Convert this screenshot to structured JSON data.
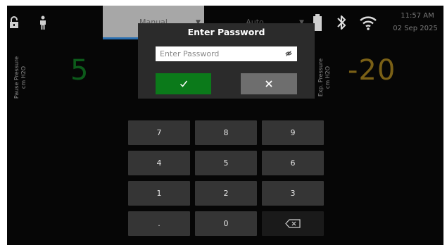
{
  "status_bar": {
    "icons": [
      "lock-icon",
      "person-icon",
      "battery-icon",
      "bluetooth-icon",
      "wifi-icon"
    ],
    "time": "11:57 AM",
    "date": "02 Sep 2025"
  },
  "mode_tabs": [
    {
      "label": "Manual"
    },
    {
      "label": "Auto"
    }
  ],
  "pause_pressure": {
    "label": "Pause Pressure",
    "unit": "cm H2O",
    "value": "5"
  },
  "exp_pressure": {
    "label": "Exp. Pressure",
    "unit": "cm H2O",
    "value": "-20"
  },
  "password_dialog": {
    "title": "Enter Password",
    "placeholder": "Enter Password",
    "icons": [
      "eye-hide-icon",
      "checkmark-icon",
      "close-icon"
    ]
  },
  "keypad": {
    "keys": [
      "7",
      "8",
      "9",
      "4",
      "5",
      "6",
      "1",
      "2",
      "3",
      ".",
      "0"
    ],
    "backspace_icon": "backspace-icon"
  },
  "colors": {
    "confirm": "#0b7a1a",
    "cancel": "#6e6e6e",
    "pause_value": "#0c5a1a",
    "exp_value": "#7a6016",
    "accent_tab": "#2a6fb0"
  }
}
